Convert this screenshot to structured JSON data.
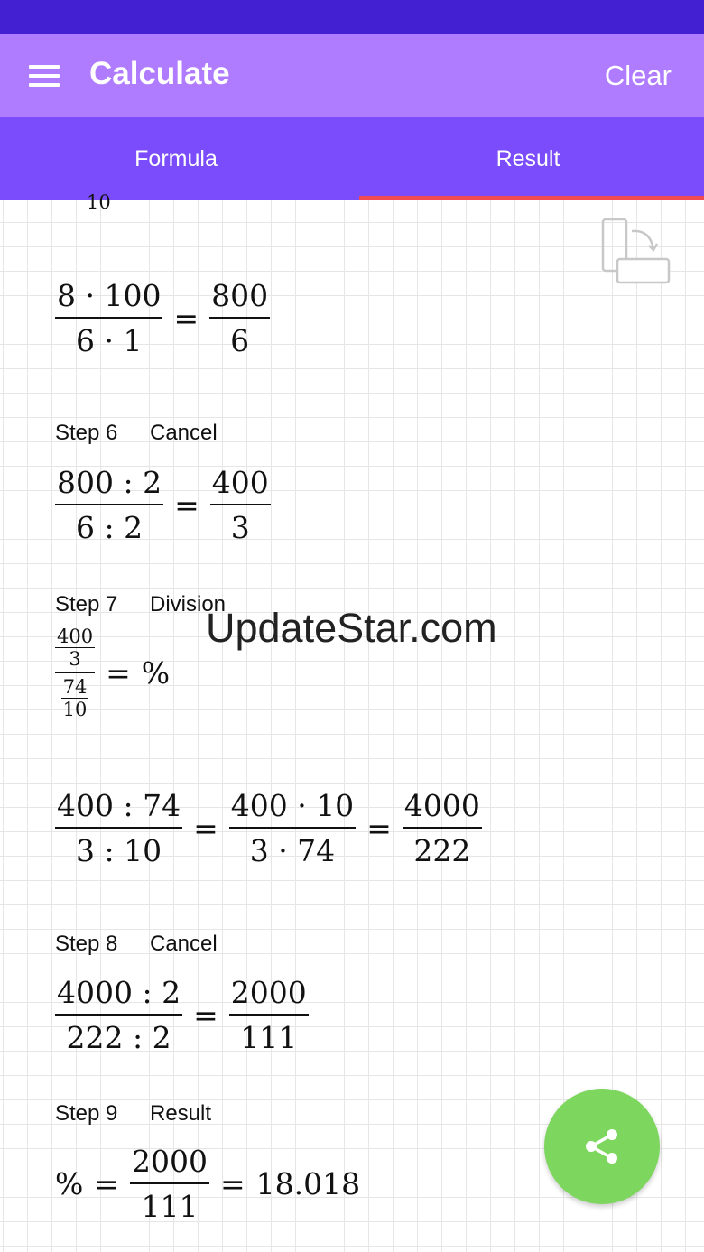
{
  "header": {
    "title": "Calculate",
    "clear_label": "Clear"
  },
  "tabs": [
    {
      "label": "Formula"
    },
    {
      "label": "Result"
    }
  ],
  "partial_top": "10",
  "eq_a": {
    "n1": "8 · 100",
    "d1": "6 · 1",
    "eq": "=",
    "n2": "800",
    "d2": "6"
  },
  "step6": {
    "step": "Step 6",
    "label": "Cancel"
  },
  "eq6": {
    "n1": "800 : 2",
    "d1": "6 : 2",
    "eq": "=",
    "n2": "400",
    "d2": "3"
  },
  "step7": {
    "step": "Step 7",
    "label": "Division"
  },
  "eq7": {
    "n1": "400",
    "d1": "3",
    "n2": "74",
    "d2": "10",
    "eq": "=",
    "rhs": "%"
  },
  "eq7b": {
    "n1": "400 : 74",
    "d1": "3 : 10",
    "eq1": "=",
    "n2": "400 · 10",
    "d2": "3 · 74",
    "eq2": "=",
    "n3": "4000",
    "d3": "222"
  },
  "step8": {
    "step": "Step 8",
    "label": "Cancel"
  },
  "eq8": {
    "n1": "4000 : 2",
    "d1": "222 : 2",
    "eq": "=",
    "n2": "2000",
    "d2": "111"
  },
  "step9": {
    "step": "Step 9",
    "label": "Result"
  },
  "eq9": {
    "lhs": "%",
    "eq1": "=",
    "n": "2000",
    "d": "111",
    "eq2": "=",
    "result": "18.018"
  },
  "watermark": "UpdateStar.com",
  "icons": {
    "menu": "menu-icon",
    "rotate": "rotate-screen-icon",
    "share": "share-icon"
  },
  "colors": {
    "status_bar": "#4321d3",
    "app_bar": "#b07cff",
    "tab_bar": "#7a4cfb",
    "tab_indicator": "#f04a52",
    "fab": "#7dd65d"
  }
}
